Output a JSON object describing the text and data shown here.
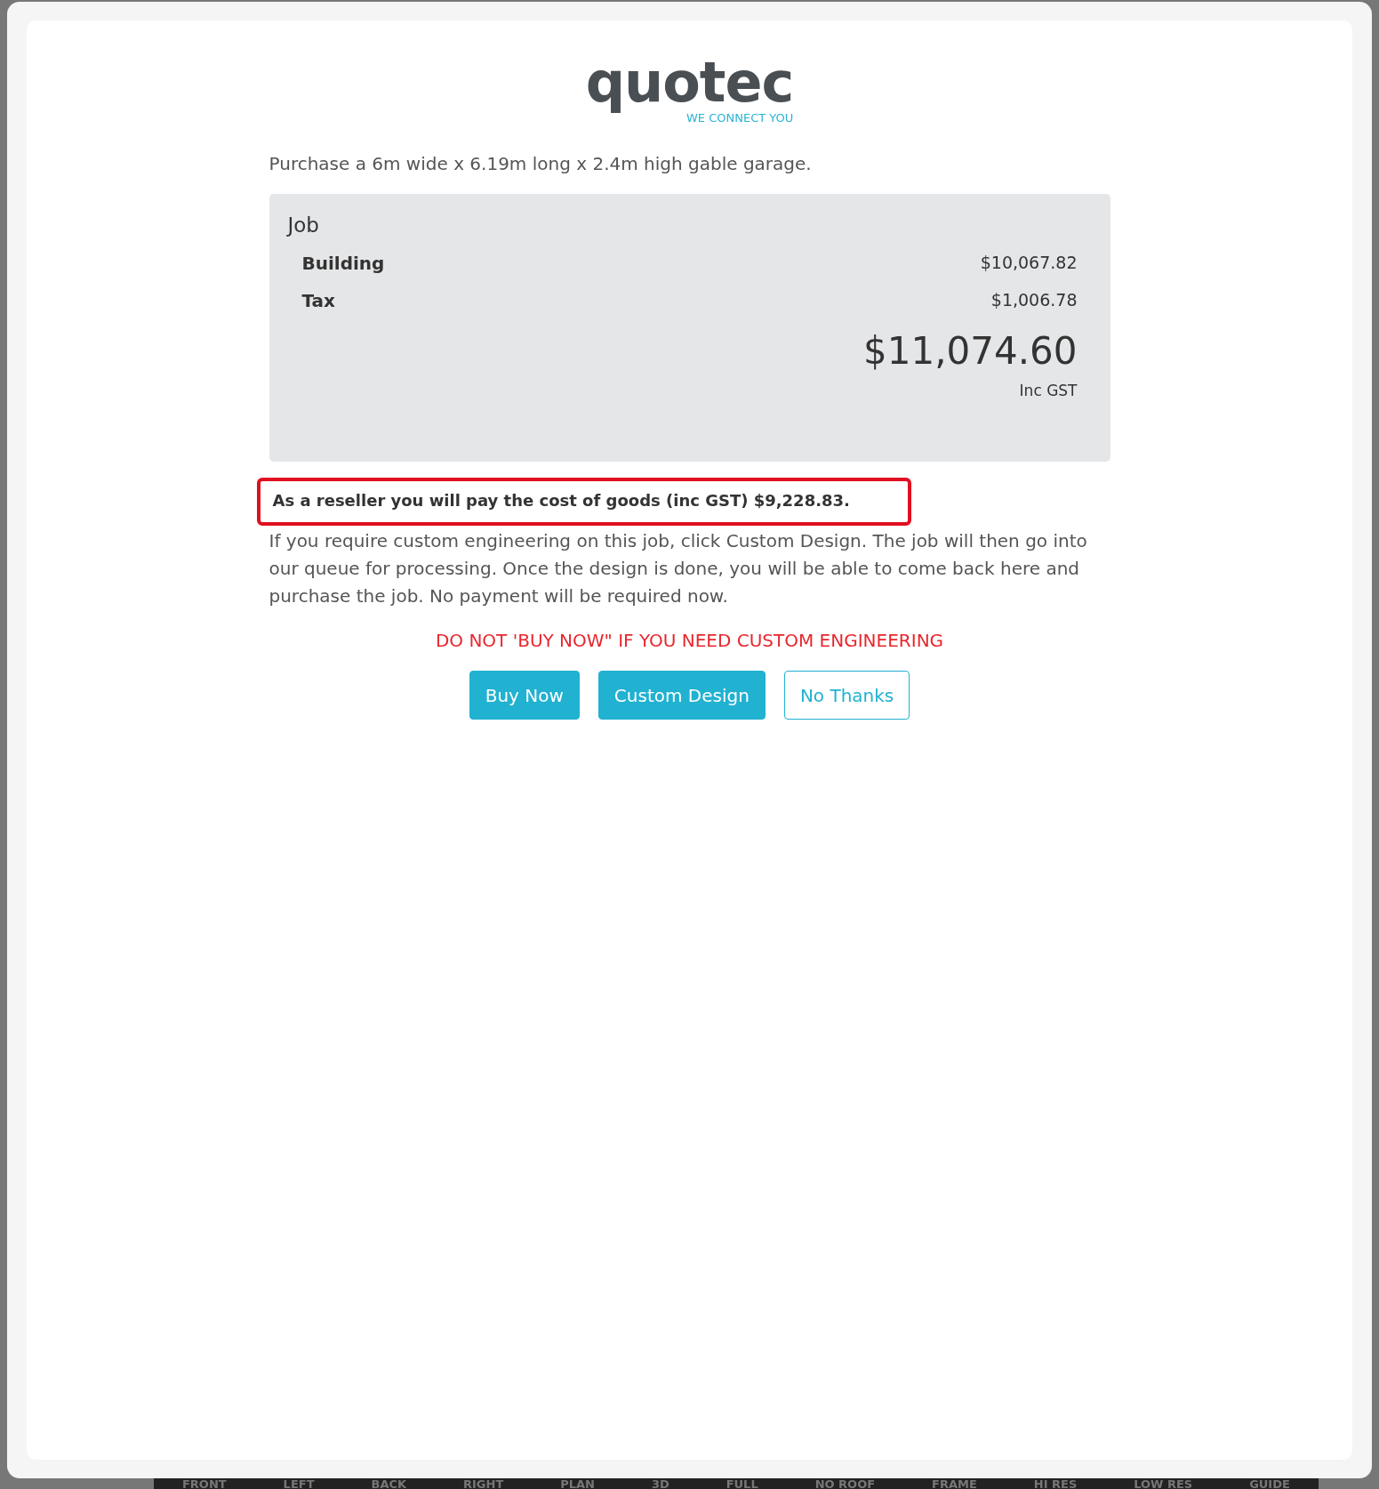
{
  "logo": {
    "name": "quotec",
    "tagline": "WE CONNECT YOU"
  },
  "intro": "Purchase a 6m wide x 6.19m long x 2.4m high gable garage.",
  "job": {
    "title": "Job",
    "lines": [
      {
        "label": "Building",
        "amount": "$10,067.82"
      },
      {
        "label": "Tax",
        "amount": "$1,006.78"
      }
    ],
    "total": "$11,074.60",
    "total_note": "Inc GST"
  },
  "reseller_note": {
    "text": "As a reseller you will pay the cost of goods (inc GST) $9,228.83.",
    "highlighted": true
  },
  "info": "If you require custom engineering on this job, click Custom Design. The job will then go into our queue for processing. Once the design is done, you will be able to come back here and purchase the job. No payment will be required now.",
  "warning": "DO NOT 'BUY NOW\" IF YOU NEED CUSTOM ENGINEERING",
  "buttons": [
    {
      "label": "Buy Now",
      "kind": "primary"
    },
    {
      "label": "Custom Design",
      "kind": "primary"
    },
    {
      "label": "No Thanks",
      "kind": "outline"
    }
  ],
  "view_toolbar": [
    "FRONT",
    "LEFT",
    "BACK",
    "RIGHT",
    "PLAN",
    "3D",
    "FULL",
    "NO ROOF",
    "FRAME",
    "HI RES",
    "LOW RES",
    "GUIDE"
  ]
}
